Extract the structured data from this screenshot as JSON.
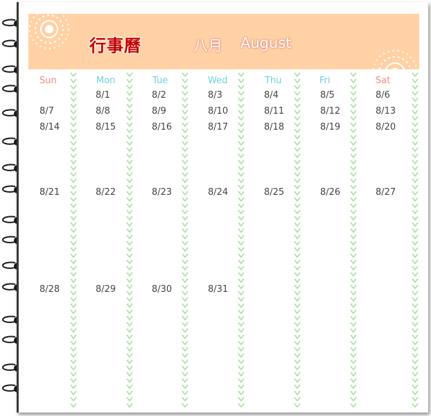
{
  "header": {
    "title": "行事曆",
    "month_zh": "八月",
    "month_en": "August"
  },
  "weekdays": [
    {
      "label": "Sun",
      "color": "#f08a80"
    },
    {
      "label": "Mon",
      "color": "#6fd0e0"
    },
    {
      "label": "Tue",
      "color": "#6fd0e0"
    },
    {
      "label": "Wed",
      "color": "#6fd0e0"
    },
    {
      "label": "Thu",
      "color": "#6fd0e0"
    },
    {
      "label": "Fri",
      "color": "#6fd0e0"
    },
    {
      "label": "Sat",
      "color": "#f08a80"
    }
  ],
  "dates": {
    "sun": [
      "8/7",
      "8/14",
      "8/21",
      "8/28"
    ],
    "mon": [
      "8/1",
      "8/8",
      "8/15",
      "8/22",
      "8/29"
    ],
    "tue": [
      "8/2",
      "8/9",
      "8/16",
      "8/23",
      "8/30"
    ],
    "wed": [
      "8/3",
      "8/10",
      "8/17",
      "8/24",
      "8/31"
    ],
    "thu": [
      "8/4",
      "8/11",
      "8/18",
      "8/25"
    ],
    "fri": [
      "8/5",
      "8/12",
      "8/19",
      "8/26"
    ],
    "sat": [
      "8/6",
      "8/13",
      "8/20",
      "8/27"
    ]
  },
  "colors": {
    "banner": "#ffd1a4",
    "title": "#c40000",
    "vine": "#a8e0a0",
    "binding": "#1a1a1a"
  }
}
